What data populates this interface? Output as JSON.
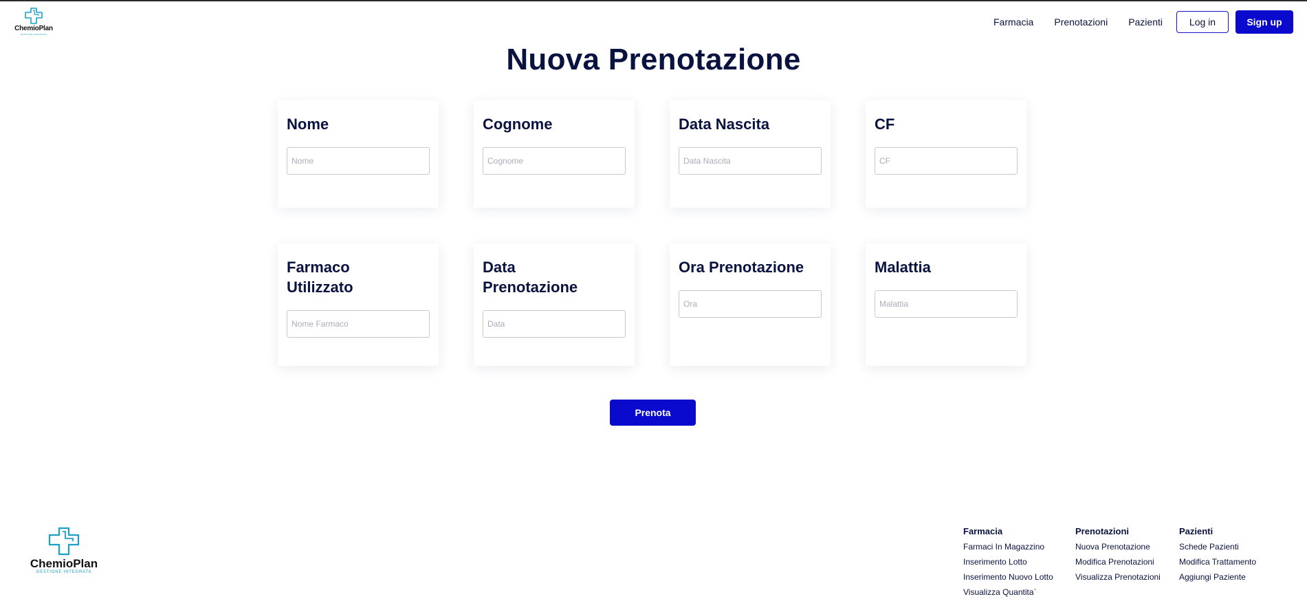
{
  "brand": {
    "name": "ChemioPlan",
    "tagline": "GESTIONE INTEGRATA",
    "accent": "#1aa0c8"
  },
  "colors": {
    "primary": "#0a0acc",
    "text": "#0a1240"
  },
  "header": {
    "nav": [
      "Farmacia",
      "Prenotazioni",
      "Pazienti"
    ],
    "login": "Log in",
    "signup": "Sign up"
  },
  "page": {
    "title": "Nuova Prenotazione"
  },
  "form": {
    "fields": [
      {
        "label": "Nome",
        "placeholder": "Nome"
      },
      {
        "label": "Cognome",
        "placeholder": "Cognome"
      },
      {
        "label": "Data Nascita",
        "placeholder": "Data Nascita"
      },
      {
        "label": "CF",
        "placeholder": "CF"
      },
      {
        "label": "Farmaco Utilizzato",
        "placeholder": "Nome Farmaco"
      },
      {
        "label": "Data Prenotazione",
        "placeholder": "Data"
      },
      {
        "label": "Ora Prenotazione",
        "placeholder": "Ora"
      },
      {
        "label": "Malattia",
        "placeholder": "Malattia"
      }
    ],
    "submit": "Prenota"
  },
  "footer": {
    "columns": [
      {
        "title": "Farmacia",
        "links": [
          "Farmaci In Magazzino",
          "Inserimento Lotto",
          "Inserimento Nuovo Lotto",
          "Visualizza Quantita`"
        ]
      },
      {
        "title": "Prenotazioni",
        "links": [
          "Nuova Prenotazione",
          "Modifica Prenotazioni",
          "Visualizza Prenotazioni"
        ]
      },
      {
        "title": "Pazienti",
        "links": [
          "Schede Pazienti",
          "Modifica Trattamento",
          "Aggiungi Paziente"
        ]
      }
    ]
  }
}
